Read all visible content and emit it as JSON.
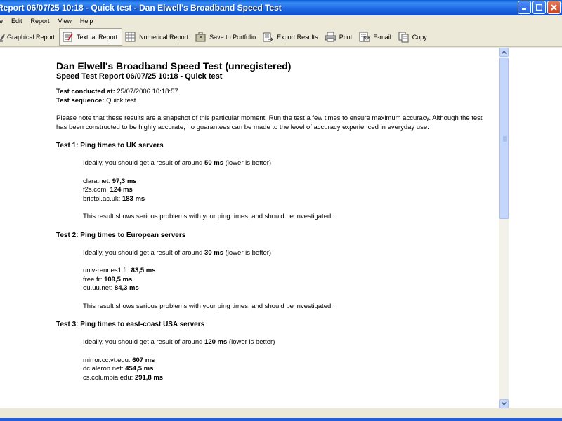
{
  "window": {
    "title": "Report 06/07/25 10:18 - Quick test - Dan Elwell's Broadband Speed Test"
  },
  "menu": [
    "e",
    "Edit",
    "Report",
    "View",
    "Help"
  ],
  "toolbar": {
    "graphical": "Graphical Report",
    "textual": "Textual Report",
    "numerical": "Numerical Report",
    "portfolio": "Save to Portfolio",
    "export": "Export Results",
    "print": "Print",
    "email": "E-mail",
    "copy": "Copy"
  },
  "report": {
    "title": "Dan Elwell's Broadband Speed Test (unregistered)",
    "subtitle": "Speed Test Report 06/07/25 10:18 - Quick test",
    "conducted_label": "Test conducted at:",
    "conducted_value": "25/07/2006 10:18:57",
    "sequence_label": "Test sequence:",
    "sequence_value": "Quick test",
    "note": "Please note that these results are a snapshot of this particular moment. Run the test a few times to ensure maximum accuracy. Although the test has been constructed to be highly accurate, no guarantees can be made to the level of accuracy experienced in everyday use.",
    "tests": [
      {
        "title": "Test 1: Ping times to UK servers",
        "ideal_prefix": "Ideally, you should get a result of around ",
        "ideal_value": "50 ms",
        "ideal_suffix": " (lower is better)",
        "results": [
          {
            "server": "clara.net:",
            "value": "97,3 ms"
          },
          {
            "server": "f2s.com:",
            "value": "124 ms"
          },
          {
            "server": "bristol.ac.uk:",
            "value": "183 ms"
          }
        ],
        "verdict": "This result shows serious problems with your ping times, and should be investigated."
      },
      {
        "title": "Test 2: Ping times to European servers",
        "ideal_prefix": "Ideally, you should get a result of around ",
        "ideal_value": "30 ms",
        "ideal_suffix": " (lower is better)",
        "results": [
          {
            "server": "univ-rennes1.fr:",
            "value": "83,5 ms"
          },
          {
            "server": "free.fr:",
            "value": "109,5 ms"
          },
          {
            "server": "eu.uu.net:",
            "value": "84,3 ms"
          }
        ],
        "verdict": "This result shows serious problems with your ping times, and should be investigated."
      },
      {
        "title": "Test 3: Ping times to east-coast USA servers",
        "ideal_prefix": "Ideally, you should get a result of around ",
        "ideal_value": "120 ms",
        "ideal_suffix": " (lower is better)",
        "results": [
          {
            "server": "mirror.cc.vt.edu:",
            "value": "607 ms"
          },
          {
            "server": "dc.aleron.net:",
            "value": "454,5 ms"
          },
          {
            "server": "cs.columbia.edu:",
            "value": "291,8 ms"
          }
        ]
      }
    ]
  },
  "colors": {
    "titlebar": "#0a5fd8",
    "chrome": "#ece9d8",
    "content_bg": "#ffffff"
  }
}
